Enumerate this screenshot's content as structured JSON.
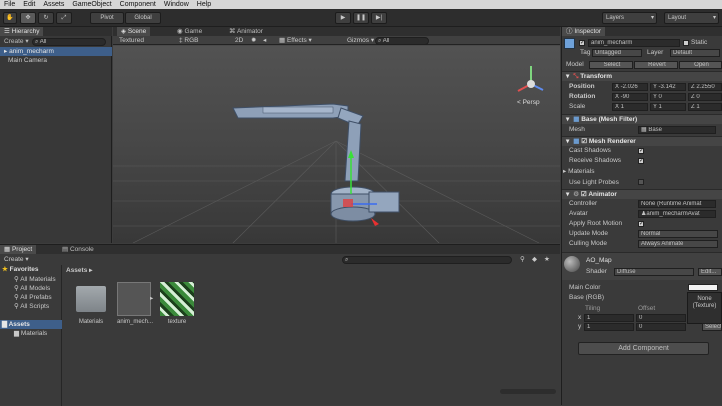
{
  "menu": [
    "File",
    "Edit",
    "Assets",
    "GameObject",
    "Component",
    "Window",
    "Help"
  ],
  "toolbar": {
    "pivot": "Pivot",
    "global": "Global",
    "layers": "Layers",
    "layout": "Layout"
  },
  "hierarchy": {
    "tab": "Hierarchy",
    "create": "Create",
    "search": "All",
    "items": [
      "anim_mecharm",
      "Main Camera"
    ]
  },
  "scene": {
    "tabs": [
      "Scene",
      "Game",
      "Animator"
    ],
    "shading": "Textured",
    "color": "RGB",
    "mode2d": "2D",
    "effects": "Effects",
    "gizmos": "Gizmos",
    "search": "All",
    "persp": "< Persp"
  },
  "inspector": {
    "tab": "Inspector",
    "name": "anim_mecharm",
    "static": "Static",
    "tag_label": "Tag",
    "tag": "Untagged",
    "layer_label": "Layer",
    "layer": "Default",
    "model_label": "Model",
    "select": "Select",
    "revert": "Revert",
    "open": "Open",
    "transform": {
      "title": "Transform",
      "position": "Position",
      "rotation": "Rotation",
      "scale": "Scale",
      "pos": [
        "X -2.026",
        "Y -3.142",
        "Z 2.2550"
      ],
      "rot": [
        "X -90",
        "Y 0",
        "Z 0"
      ],
      "scl": [
        "X 1",
        "Y 1",
        "Z 1"
      ]
    },
    "meshfilter": {
      "title": "Base (Mesh Filter)",
      "mesh_label": "Mesh",
      "mesh": "Base"
    },
    "meshrenderer": {
      "title": "Mesh Renderer",
      "cast": "Cast Shadows",
      "receive": "Receive Shadows",
      "materials": "Materials",
      "probes": "Use Light Probes"
    },
    "animator": {
      "title": "Animator",
      "controller_label": "Controller",
      "controller": "None (Runtime Animat",
      "avatar_label": "Avatar",
      "avatar": "anim_mecharmAvat",
      "root": "Apply Root Motion",
      "update_label": "Update Mode",
      "update": "Normal",
      "culling_label": "Culling Mode",
      "culling": "Always Animate"
    },
    "material": {
      "name": "AO_Map",
      "shader_label": "Shader",
      "shader": "Diffuse",
      "edit": "Edit...",
      "main_color": "Main Color",
      "base": "Base (RGB)",
      "tiling": "Tiling",
      "offset": "Offset",
      "x": "x",
      "y": "y",
      "t1": "1",
      "t2": "1",
      "o1": "0",
      "o2": "0",
      "none": "None",
      "texture": "(Texture)",
      "select": "Select"
    },
    "add_component": "Add Component"
  },
  "project": {
    "tabs": [
      "Project",
      "Console"
    ],
    "create": "Create",
    "favorites": "Favorites",
    "fav_items": [
      "All Materials",
      "All Models",
      "All Prefabs",
      "All Scripts"
    ],
    "assets": "Assets",
    "asset_tree": [
      "Materials"
    ],
    "breadcrumb": "Assets",
    "files": [
      "Materials",
      "anim_mech...",
      "texture"
    ]
  }
}
